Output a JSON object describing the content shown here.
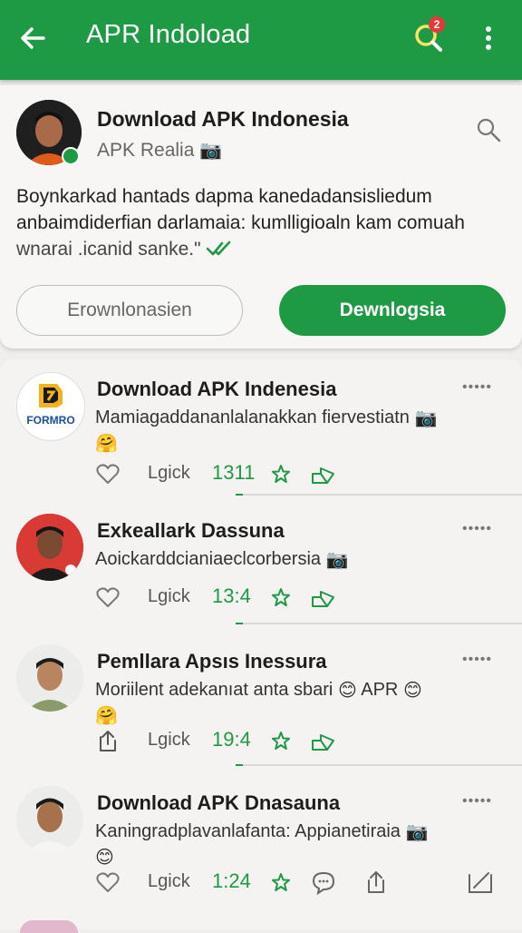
{
  "appbar": {
    "title": "APR Indoload",
    "notification_count": "2",
    "brand_color": "#1e9a45"
  },
  "header_card": {
    "name": "Download APK Indonesia",
    "subtitle": "APK Realia",
    "body_line1": "Boynkarkad hantads dapma kanedadansisliedum",
    "body_line2": "anbaimdiderfian darlamaia: kumlligioaln kam comuah",
    "body_line3": "wnarai .icanid sanke.\"",
    "button_outline": "Erownlonasien",
    "button_fill": "Dewnlogsia"
  },
  "posts": [
    {
      "name": "Download APK Indenesia",
      "text": "Mamiagaddananlalanakkan fiervestiatn",
      "menu": "•••••",
      "like_label": "Lgick",
      "count": "1311",
      "logo_text": "FORMRO"
    },
    {
      "name": "Exkeallark Dassuna",
      "text": "Aoickarddcianiaeclcorbersia",
      "menu": "•••••",
      "like_label": "Lgick",
      "count": "13:4"
    },
    {
      "name": "Pemllara  Apsıs Inessura",
      "text": "Moriilent adekanıat anta sbari",
      "text_suffix": "APR",
      "menu": "•••••",
      "like_label": "Lgick",
      "count": "19:4"
    },
    {
      "name": "Download APK Dnasauna",
      "text": "Kaningradplavanlafanta: Appianetiraia",
      "menu": "•••••",
      "like_label": "Lgick",
      "count": "1:24"
    }
  ],
  "icons": {
    "back": "arrow-left-icon",
    "search": "search-icon",
    "menu": "more-vert-icon",
    "like": "heart-icon",
    "star": "star-icon",
    "share": "share-icon",
    "upload": "upload-icon",
    "comment": "comment-icon",
    "edit": "edit-icon"
  }
}
